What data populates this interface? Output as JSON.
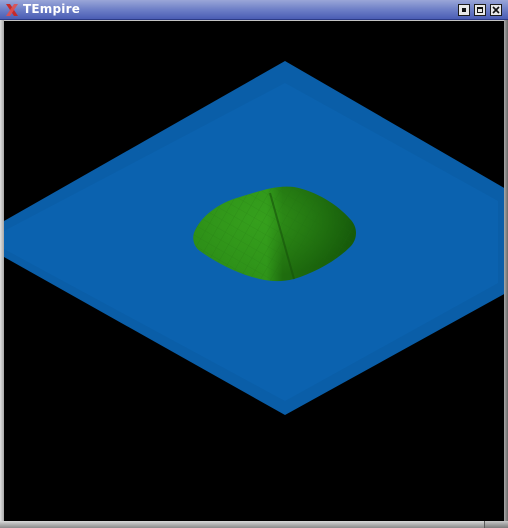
{
  "window": {
    "title": "TEmpire",
    "app_icon": "x-logo-icon",
    "buttons": {
      "minimize": "minimize-icon",
      "maximize": "maximize-icon",
      "close": "close-icon"
    }
  },
  "scene": {
    "background_color": "#000000",
    "water_color": "#0a5ea8",
    "land_color": "#2e8a18"
  }
}
